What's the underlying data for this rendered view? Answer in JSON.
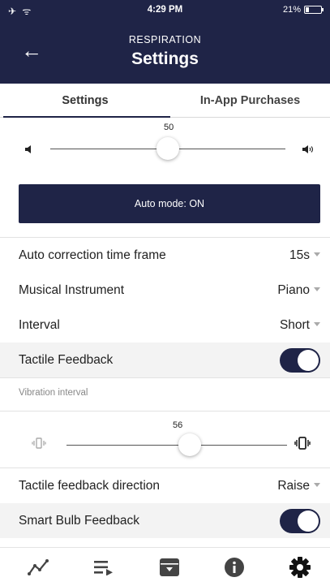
{
  "status_bar": {
    "time": "4:29 PM",
    "battery": "21%"
  },
  "header": {
    "subtitle": "RESPIRATION",
    "title": "Settings"
  },
  "tabs": [
    {
      "label": "Settings",
      "active": true
    },
    {
      "label": "In-App Purchases",
      "active": false
    }
  ],
  "volume": {
    "value": "50",
    "level_percent": 50
  },
  "auto_mode": {
    "label": "Auto mode: ON"
  },
  "settings": {
    "auto_correction": {
      "label": "Auto correction time frame",
      "value": "15s"
    },
    "instrument": {
      "label": "Musical Instrument",
      "value": "Piano"
    },
    "interval": {
      "label": "Interval",
      "value": "Short"
    },
    "tactile": {
      "label": "Tactile Feedback",
      "on": true
    },
    "vibration": {
      "label": "Vibration interval",
      "value": "56",
      "level_percent": 56
    },
    "tactile_direction": {
      "label": "Tactile feedback direction",
      "value": "Raise"
    },
    "smart_bulb": {
      "label": "Smart Bulb Feedback",
      "on": true
    }
  },
  "bottom_tabs": [
    {
      "icon": "trend-line-icon"
    },
    {
      "icon": "playlist-icon"
    },
    {
      "icon": "archive-box-icon"
    },
    {
      "icon": "info-icon"
    },
    {
      "icon": "gear-icon",
      "active": true
    }
  ],
  "colors": {
    "primary": "#1f2447",
    "background": "#ffffff",
    "row_highlight": "#f3f3f3"
  }
}
